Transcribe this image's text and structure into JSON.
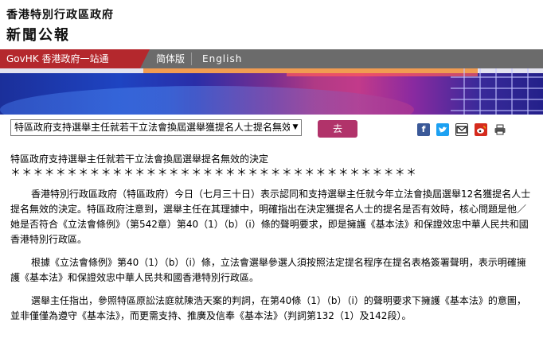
{
  "masthead": {
    "government_name": "香港特別行政區政府",
    "press_title": "新聞公報"
  },
  "nav": {
    "govhk": "GovHK 香港政府一站通",
    "simplified": "简体版",
    "english": "English"
  },
  "toolbar": {
    "select_value": "特區政府支持選舉主任就若干立法會換屆選舉獲提名人士提名無效的決定",
    "go_label": "去"
  },
  "share_icons": [
    "facebook-icon",
    "twitter-icon",
    "email-icon",
    "weibo-icon",
    "print-icon"
  ],
  "colors": {
    "govhk_red": "#b4282d",
    "nav_grey": "#6b6b6b",
    "go_button": "#b1336a",
    "facebook": "#3b5998",
    "twitter": "#1da1f2",
    "weibo": "#d52b1e"
  },
  "article": {
    "headline": "特區政府支持選舉主任就若干立法會換屆選舉提名無效的決定",
    "stars": "＊＊＊＊＊＊＊＊＊＊＊＊＊＊＊＊＊＊＊＊＊＊＊＊＊＊＊＊＊＊＊＊＊＊＊＊",
    "paragraphs": [
      "香港特別行政區政府（特區政府）今日（七月三十日）表示認同和支持選舉主任就今年立法會換屆選舉12名獲提名人士提名無效的決定。特區政府注意到，選舉主任在其理據中，明確指出在決定獲提名人士的提名是否有效時，核心問題是他／她是否符合《立法會條例》（第542章）第40（1）（b）（i）條的聲明要求，即是擁護《基本法》和保證效忠中華人民共和國香港特別行政區。",
      "根據《立法會條例》第40（1）（b）（i）條，立法會選舉參選人須按照法定提名程序在提名表格簽署聲明，表示明確擁護《基本法》和保證效忠中華人民共和國香港特別行政區。",
      "選舉主任指出，參照特區原訟法庭就陳浩天案的判詞，在第40條（1）（b）（i）的聲明要求下擁護《基本法》的意圖，並非僅僅為遵守《基本法》，而更需支持、推廣及信奉《基本法》（判詞第132（1）及142段）。"
    ]
  }
}
